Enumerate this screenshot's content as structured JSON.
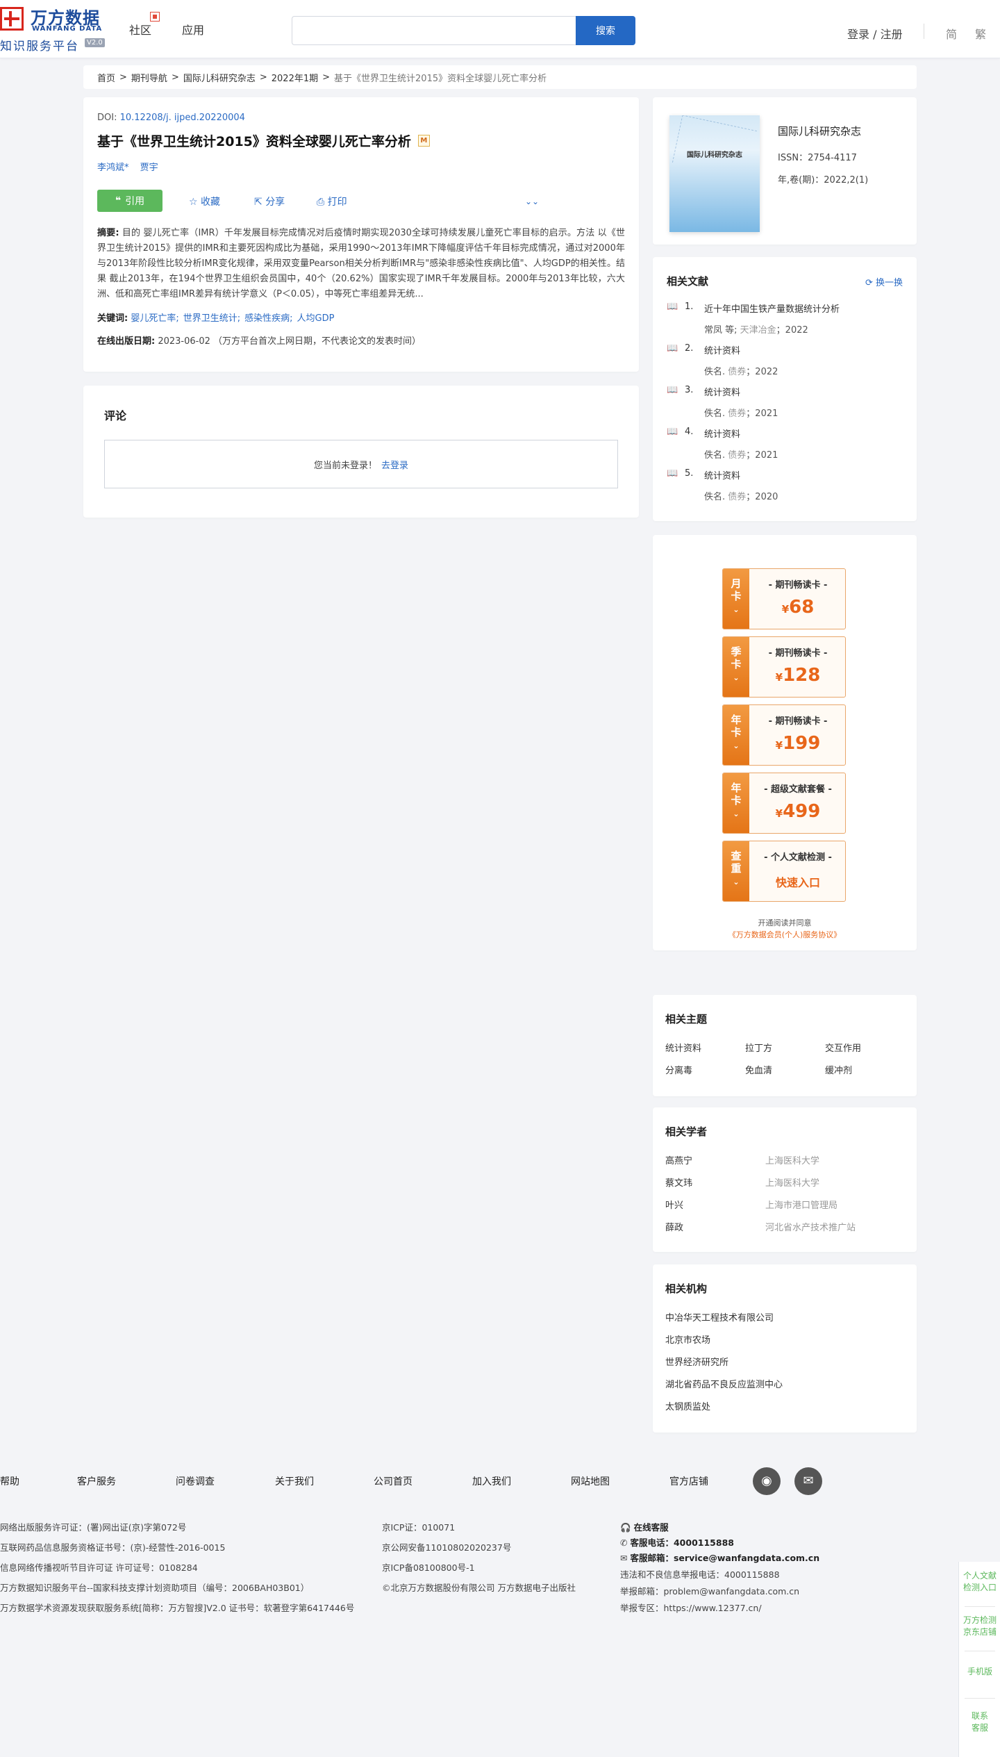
{
  "header": {
    "logo_cn": "万方数据",
    "logo_en": "WANFANG DATA",
    "logo_sub": "知识服务平台",
    "logo_version": "V2.0",
    "nav": [
      "社区",
      "应用"
    ],
    "search_button": "搜索",
    "login": "登录 / 注册",
    "lang_simplified": "简",
    "lang_traditional": "繁"
  },
  "breadcrumb": [
    "首页",
    "期刊导航",
    "国际儿科研究杂志",
    "2022年1期",
    "基于《世界卫生统计2015》资料全球婴儿死亡率分析"
  ],
  "article": {
    "doi_label": "DOI:",
    "doi": "10.12208/j. ijped.20220004",
    "title": "基于《世界卫生统计2015》资料全球婴儿死亡率分析",
    "title_badge": "M",
    "authors": [
      "李鸿斌*",
      "贾宇"
    ],
    "cite_button": "引用",
    "actions": [
      "收藏",
      "分享",
      "打印"
    ],
    "abstract_label": "摘要:",
    "abstract": "目的 婴儿死亡率（IMR）千年发展目标完成情况对后疫情时期实现2030全球可持续发展儿童死亡率目标的启示。方法 以《世界卫生统计2015》提供的IMR和主要死因构成比为基础，采用1990～2013年IMR下降幅度评估千年目标完成情况，通过对2000年与2013年阶段性比较分析IMR变化规律，采用双变量Pearson相关分析判断IMR与\"感染非感染性疾病比值\"、人均GDP的相关性。结果 截止2013年，在194个世界卫生组织会员国中，40个（20.62%）国家实现了IMR千年发展目标。2000年与2013年比较，六大洲、低和高死亡率组IMR差异有统计学意义（P＜0.05），中等死亡率组差异无统...",
    "keywords_label": "关键词:",
    "keywords": [
      "婴儿死亡率;",
      "世界卫生统计;",
      "感染性疾病;",
      "人均GDP"
    ],
    "pubdate_label": "在线出版日期:",
    "pubdate": "2023-06-02",
    "pubdate_note": "（万方平台首次上网日期，不代表论文的发表时间）"
  },
  "comments": {
    "title": "评论",
    "not_logged_in": "您当前未登录！",
    "login_link": "去登录"
  },
  "journal": {
    "cover_title": "国际儿科研究杂志",
    "name": "国际儿科研究杂志",
    "issn": "ISSN：2754-4117",
    "volume": "年,卷(期)：2022,2(1)"
  },
  "related_docs": {
    "title": "相关文献",
    "refresh": "换一换",
    "items": [
      {
        "num": "1.",
        "title": "近十年中国生铁产量数据统计分析",
        "author": "常凤  等;",
        "source": "天津冶金",
        "year": "；2022"
      },
      {
        "num": "2.",
        "title": "统计资料",
        "author": "佚名.",
        "source": "债券",
        "year": "；2022"
      },
      {
        "num": "3.",
        "title": "统计资料",
        "author": "佚名.",
        "source": "债券",
        "year": "；2021"
      },
      {
        "num": "4.",
        "title": "统计资料",
        "author": "佚名.",
        "source": "债券",
        "year": "；2021"
      },
      {
        "num": "5.",
        "title": "统计资料",
        "author": "佚名.",
        "source": "债券",
        "year": "；2020"
      }
    ]
  },
  "promo": {
    "cards": [
      {
        "side": [
          "月",
          "卡"
        ],
        "title": "- 期刊畅读卡 -",
        "currency": "¥",
        "price": "68"
      },
      {
        "side": [
          "季",
          "卡"
        ],
        "title": "- 期刊畅读卡 -",
        "currency": "¥",
        "price": "128"
      },
      {
        "side": [
          "年",
          "卡"
        ],
        "title": "- 期刊畅读卡 -",
        "currency": "¥",
        "price": "199"
      },
      {
        "side": [
          "年",
          "卡"
        ],
        "title": "- 超级文献套餐 -",
        "currency": "¥",
        "price": "499"
      },
      {
        "side": [
          "查",
          "重"
        ],
        "title": "- 个人文献检测 -",
        "entry": "快速入口"
      }
    ],
    "agree_text": "开通阅读并同意",
    "agree_link": "《万方数据会员(个人)服务协议》"
  },
  "topics": {
    "title": "相关主题",
    "items": [
      "统计资料",
      "拉丁方",
      "交互作用",
      "分离毒",
      "免血清",
      "缓冲剂"
    ]
  },
  "scholars": {
    "title": "相关学者",
    "items": [
      {
        "name": "高燕宁",
        "org": "上海医科大学"
      },
      {
        "name": "蔡文玮",
        "org": "上海医科大学"
      },
      {
        "name": "叶兴",
        "org": "上海市港口管理局"
      },
      {
        "name": "薛政",
        "org": "河北省水产技术推广站"
      }
    ]
  },
  "orgs": {
    "title": "相关机构",
    "items": [
      "中冶华天工程技术有限公司",
      "北京市农场",
      "世界经济研究所",
      "湖北省药品不良反应监测中心",
      "太钢质监处"
    ]
  },
  "footer": {
    "nav": [
      "帮助",
      "客户服务",
      "问卷调查",
      "关于我们",
      "公司首页",
      "加入我们",
      "网站地图",
      "官方店铺"
    ],
    "col1": [
      "网络出版服务许可证：(署)网出证(京)字第072号",
      "互联网药品信息服务资格证书号：(京)-经营性-2016-0015",
      "信息网络传播视听节目许可证 许可证号：0108284",
      "万方数据知识服务平台--国家科技支撑计划资助项目（编号：2006BAH03B01）",
      "万方数据学术资源发现获取服务系统[简称：万方智搜]V2.0 证书号：软著登字第6417446号"
    ],
    "col2": [
      "京ICP证：010071",
      "京公网安备11010802020237号",
      "京ICP备08100800号-1",
      "©北京万方数据股份有限公司 万方数据电子出版社"
    ],
    "online_service": "在线客服",
    "phone_label": "客服电话：",
    "phone": "4000115888",
    "email_label": "客服邮箱：",
    "email": "service@wanfangdata.com.cn",
    "report_phone": "违法和不良信息举报电话：4000115888",
    "report_email": "举报邮箱：problem@wanfangdata.com.cn",
    "report_zone": "举报专区：https://www.12377.cn/"
  },
  "float_bar": [
    "个人文献检测入口",
    "万方检测京东店铺",
    "手机版",
    "联系客服"
  ]
}
